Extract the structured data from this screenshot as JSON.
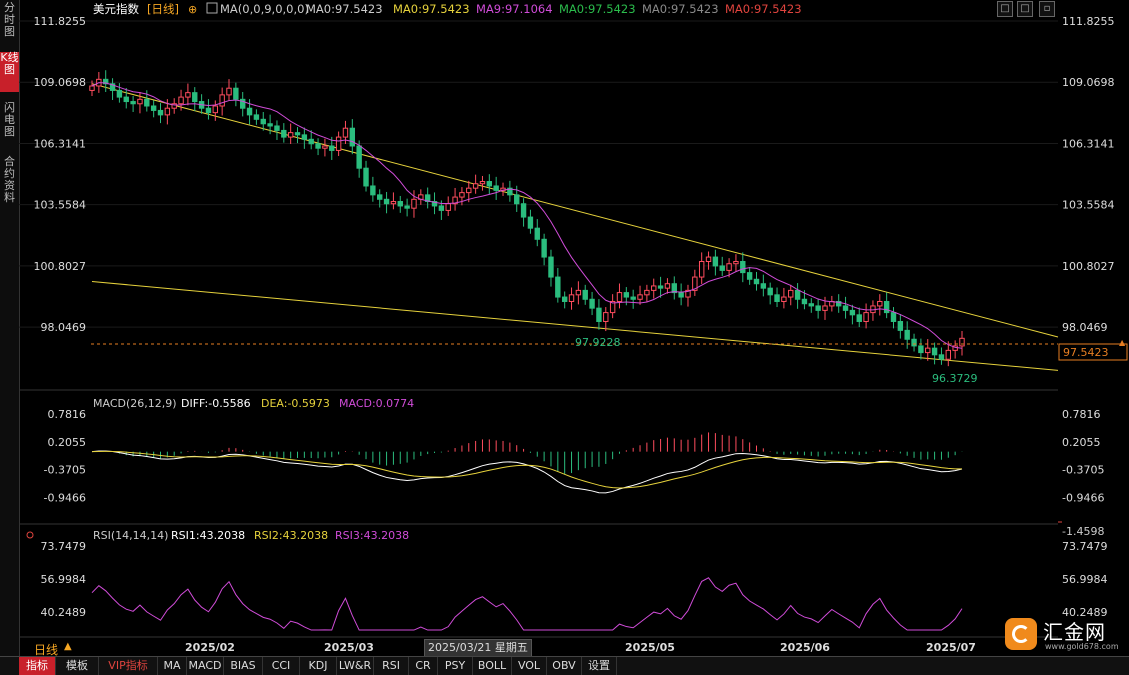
{
  "side_tabs": [
    {
      "label": "分时图",
      "active": false
    },
    {
      "label": "K线图",
      "active": true
    },
    {
      "label": "闪电图",
      "active": false
    },
    {
      "label": "合约资料",
      "active": false
    }
  ],
  "header": {
    "symbol": "美元指数",
    "period_tag": "[日线]",
    "ma_label": "MA(0,0,9,0,0,0)",
    "ma_values": [
      {
        "text": "MA0:97.5423",
        "color": "#cccccc"
      },
      {
        "text": "MA0:97.5423",
        "color": "#e6d23c"
      },
      {
        "text": "MA9:97.1064",
        "color": "#d04cd8"
      },
      {
        "text": "MA0:97.5423",
        "color": "#2bbd4c"
      },
      {
        "text": "MA0:97.5423",
        "color": "#8a8a8a"
      },
      {
        "text": "MA0:97.5423",
        "color": "#e0443e"
      }
    ]
  },
  "price_axis": {
    "ticks": [
      "111.8255",
      "109.0698",
      "106.3141",
      "103.5584",
      "100.8027",
      "98.0469"
    ],
    "current_price": "97.5423"
  },
  "annotations": {
    "high_label": "97.9228",
    "low_label": "96.3729"
  },
  "macd": {
    "title": "MACD(26,12,9)",
    "diff": "DIFF:-0.5586",
    "dea": "DEA:-0.5973",
    "macd": "MACD:0.0774",
    "ticks": [
      "0.7816",
      "0.2055",
      "-0.3705",
      "-0.9466"
    ],
    "bottom_value": "-1.4598"
  },
  "rsi": {
    "title": "RSI(14,14,14)",
    "rsi1": "RSI1:43.2038",
    "rsi2": "RSI2:43.2038",
    "rsi3": "RSI3:43.2038",
    "ticks": [
      "73.7479",
      "56.9984",
      "40.2489"
    ]
  },
  "x_axis": {
    "labels": [
      "2025/02",
      "2025/03",
      "2025/05",
      "2025/06",
      "2025/07"
    ],
    "hover_date": "2025/03/21 星期五"
  },
  "period_selector": "日线",
  "toolbar": [
    "指标",
    "模板",
    "VIP指标",
    "MA",
    "MACD",
    "BIAS",
    "CCI",
    "KDJ",
    "LW&R",
    "RSI",
    "CR",
    "PSY",
    "BOLL",
    "VOL",
    "OBV",
    "设置"
  ],
  "logo": {
    "name": "汇金网",
    "url": "www.gold678.com"
  },
  "colors": {
    "up": "#ff4d5e",
    "down": "#2bbd7e",
    "ma9": "#d04cd8",
    "trend": "#e6d23c",
    "accent": "#c8202a"
  },
  "chart_data": {
    "type": "candlestick",
    "symbol": "美元指数",
    "period": "日线",
    "ylim": [
      96.0,
      111.8255
    ],
    "x": [
      "2025/02",
      "2025/03",
      "2025/05",
      "2025/06",
      "2025/07"
    ],
    "ohlc_close": [
      108.9,
      109.2,
      109.0,
      108.7,
      108.4,
      108.2,
      108.1,
      108.3,
      108.0,
      107.8,
      107.6,
      107.9,
      108.1,
      108.4,
      108.6,
      108.2,
      107.9,
      107.7,
      108.0,
      108.5,
      108.8,
      108.3,
      107.9,
      107.6,
      107.4,
      107.2,
      107.1,
      106.9,
      106.6,
      106.8,
      106.7,
      106.5,
      106.3,
      106.1,
      106.2,
      106.0,
      106.6,
      107.0,
      106.2,
      105.2,
      104.4,
      104.0,
      103.8,
      103.6,
      103.7,
      103.5,
      103.4,
      103.8,
      104.0,
      103.7,
      103.5,
      103.3,
      103.6,
      103.9,
      104.1,
      104.3,
      104.5,
      104.6,
      104.4,
      104.2,
      104.3,
      104.0,
      103.6,
      103.0,
      102.5,
      102.0,
      101.2,
      100.3,
      99.4,
      99.2,
      99.5,
      99.7,
      99.3,
      98.9,
      98.3,
      98.7,
      99.2,
      99.6,
      99.4,
      99.3,
      99.5,
      99.7,
      99.9,
      99.8,
      100.0,
      99.6,
      99.4,
      99.7,
      100.3,
      101.0,
      101.2,
      100.8,
      100.6,
      100.9,
      101.0,
      100.5,
      100.2,
      100.0,
      99.8,
      99.5,
      99.2,
      99.4,
      99.7,
      99.3,
      99.1,
      99.0,
      98.8,
      99.0,
      99.2,
      99.0,
      98.8,
      98.6,
      98.3,
      98.7,
      99.0,
      99.2,
      98.7,
      98.3,
      97.9,
      97.5,
      97.2,
      96.9,
      97.1,
      96.8,
      96.6,
      97.0,
      97.2,
      97.5423
    ],
    "ma9_label": "MA9:97.1064",
    "trendlines": [
      {
        "from": [
          0,
          109.0
        ],
        "to": [
          "2025/07+",
          97.6
        ]
      },
      {
        "from": [
          0,
          100.1
        ],
        "to": [
          "2025/07+",
          96.1
        ]
      }
    ],
    "macd": {
      "diff": -0.5586,
      "dea": -0.5973,
      "macd": 0.0774,
      "ylim": [
        -1.4598,
        0.7816
      ]
    },
    "rsi": {
      "rsi1": 43.2038,
      "rsi2": 43.2038,
      "rsi3": 43.2038,
      "ylim": [
        30,
        80
      ]
    }
  }
}
